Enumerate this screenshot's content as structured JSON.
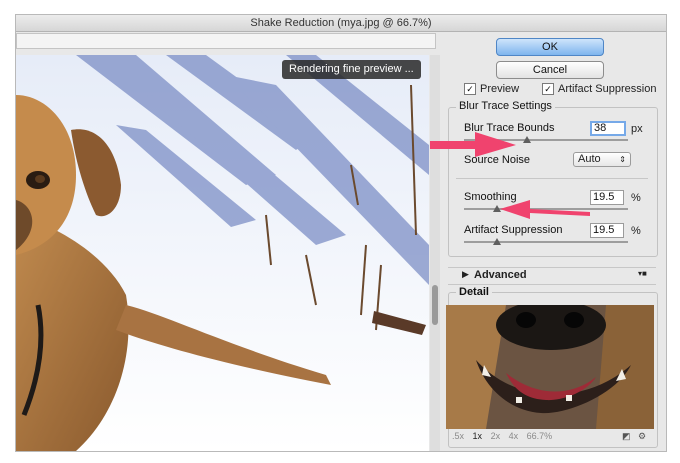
{
  "window": {
    "title": "Shake Reduction (mya.jpg @ 66.7%)"
  },
  "preview": {
    "overlay_text": "Rendering fine preview ..."
  },
  "buttons": {
    "ok": "OK",
    "cancel": "Cancel"
  },
  "options": {
    "preview_label": "Preview",
    "preview_checked": true,
    "artifact_suppression_label": "Artifact Suppression",
    "artifact_suppression_checked": true
  },
  "blur_trace": {
    "group_title": "Blur Trace Settings",
    "bounds_label": "Blur Trace Bounds",
    "bounds_value": "38",
    "bounds_unit": "px",
    "bounds_slider_fraction": 0.38,
    "noise_label": "Source Noise",
    "noise_value": "Auto",
    "smoothing_label": "Smoothing",
    "smoothing_value": "19.5",
    "smoothing_unit": "%",
    "smoothing_slider_fraction": 0.2,
    "artifact_label": "Artifact Suppression",
    "artifact_value": "19.5",
    "artifact_unit": "%",
    "artifact_slider_fraction": 0.2
  },
  "advanced": {
    "label": "Advanced"
  },
  "detail": {
    "group_title": "Detail",
    "zoom_options": [
      ".5x",
      "1x",
      "2x",
      "4x",
      "66.7%"
    ],
    "zoom_selected": "1x"
  },
  "icons": {
    "disclosure": "triangle-right-icon",
    "detail_toggle": "loupe-toggle-icon",
    "detail_settings": "gear-icon",
    "advanced_menu": "menu-dropdown-icon"
  },
  "colors": {
    "annotation_arrow": "#f0436e",
    "ok_button": "#7fb5ee",
    "focus_ring": "#76a9e8"
  }
}
